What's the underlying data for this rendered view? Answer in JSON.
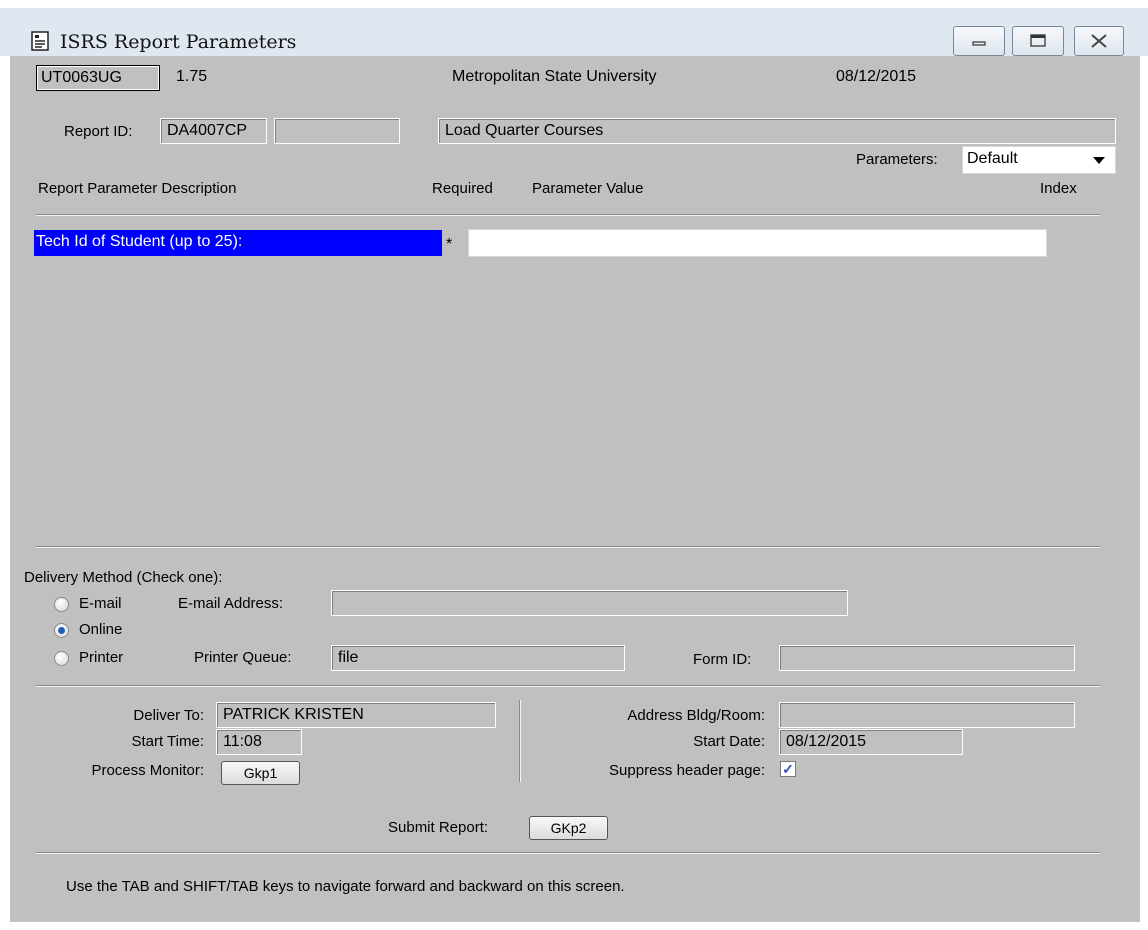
{
  "window": {
    "title": "ISRS Report Parameters",
    "controls": {
      "minimize": "▭",
      "maximize": "▣",
      "close": "✕"
    }
  },
  "header": {
    "app_code": "UT0063UG",
    "version": "1.75",
    "institution": "Metropolitan State University",
    "date": "08/12/2015"
  },
  "report": {
    "id_label": "Report ID:",
    "id_value": "DA4007CP",
    "id_extra": "",
    "name": "Load Quarter Courses",
    "parameters_label": "Parameters:",
    "parameters_value": "Default"
  },
  "columns": {
    "description": "Report Parameter Description",
    "required": "Required",
    "value": "Parameter Value",
    "index": "Index"
  },
  "parameter_rows": [
    {
      "description": "Tech Id of Student (up to 25):",
      "required": "*",
      "value": ""
    }
  ],
  "delivery": {
    "heading": "Delivery Method (Check one):",
    "options": [
      {
        "label": "E-mail",
        "selected": false
      },
      {
        "label": "Online",
        "selected": true
      },
      {
        "label": "Printer",
        "selected": false
      }
    ],
    "email_label": "E-mail Address:",
    "email_value": "",
    "printer_queue_label": "Printer Queue:",
    "printer_queue_value": "file",
    "form_id_label": "Form ID:",
    "form_id_value": ""
  },
  "details": {
    "deliver_to_label": "Deliver To:",
    "deliver_to_value": "PATRICK KRISTEN",
    "start_time_label": "Start Time:",
    "start_time_value": "11:08",
    "process_monitor_label": "Process Monitor:",
    "process_monitor_button": "Gkp1",
    "address_label": "Address Bldg/Room:",
    "address_value": "",
    "start_date_label": "Start Date:",
    "start_date_value": "08/12/2015",
    "suppress_label": "Suppress header page:",
    "suppress_checked": true,
    "check_mark": "✓"
  },
  "submit": {
    "label": "Submit Report:",
    "button": "GKp2"
  },
  "footer": {
    "hint": "Use the TAB and SHIFT/TAB keys to navigate forward and backward on this screen."
  },
  "icons": {
    "window_icon": "report-icon",
    "dropdown_icon": "dropdown-arrow-icon"
  }
}
